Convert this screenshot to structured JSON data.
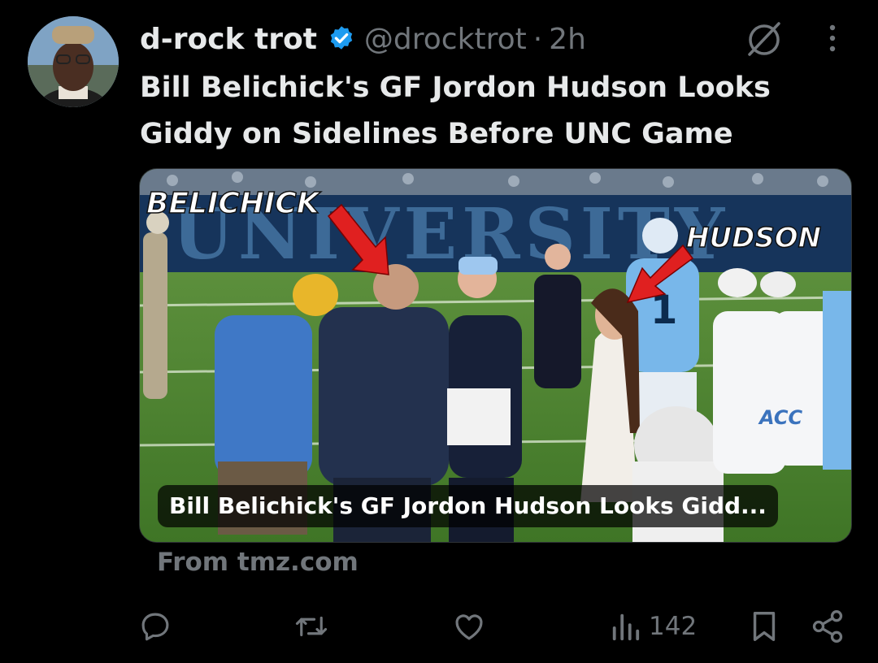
{
  "tweet": {
    "author_name": "d-rock trot",
    "handle": "@drocktrot",
    "separator": "·",
    "time": "2h",
    "text": "Bill Belichick's GF Jordon Hudson Looks Giddy on Sidelines Before UNC Game"
  },
  "card": {
    "caption": "Bill Belichick's GF Jordon Hudson Looks Gidd...",
    "overlay_left": "BELICHICK",
    "overlay_right": "HUDSON",
    "banner_text": "UNIVERSITY",
    "jersey_number": "1",
    "sleeve_text": "ACC",
    "source": "From tmz.com"
  },
  "actions": {
    "views": "142"
  },
  "colors": {
    "background": "#000000",
    "text_primary": "#e7e9ea",
    "text_secondary": "#71767b",
    "verified": "#1d9bf0",
    "arrow_red": "#e02020"
  },
  "icons": [
    "verified-badge-icon",
    "grok-icon",
    "more-vertical-icon",
    "reply-icon",
    "repost-icon",
    "like-icon",
    "views-icon",
    "bookmark-icon",
    "share-icon"
  ]
}
